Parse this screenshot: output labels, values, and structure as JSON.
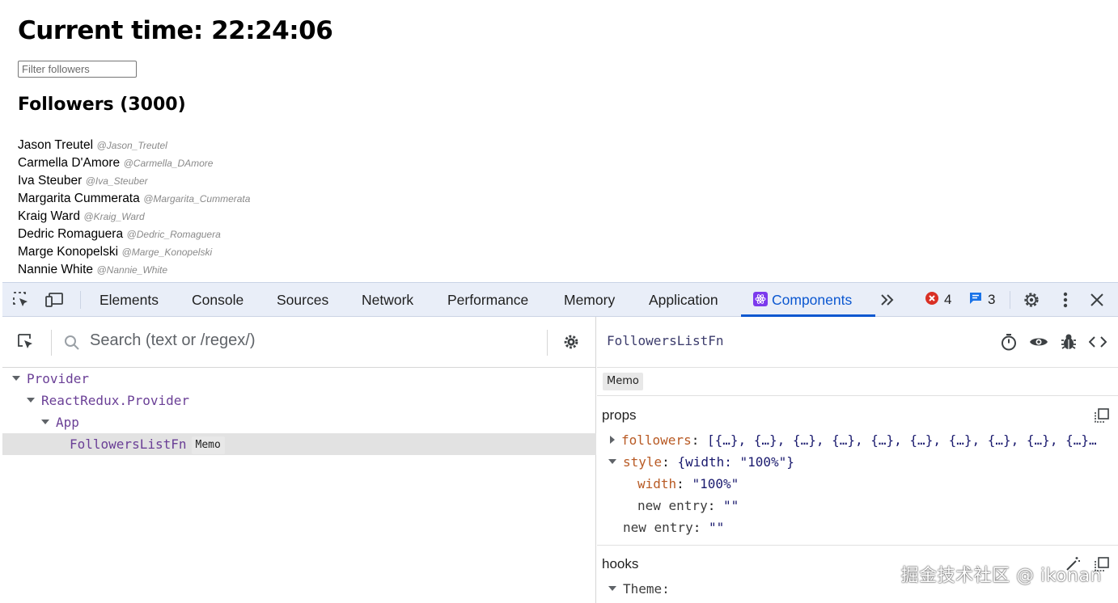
{
  "app": {
    "title": "Current time: 22:24:06",
    "filter_placeholder": "Filter followers",
    "followers_heading": "Followers (3000)",
    "followers": [
      {
        "name": "Jason Treutel",
        "handle": "@Jason_Treutel"
      },
      {
        "name": "Carmella D'Amore",
        "handle": "@Carmella_DAmore"
      },
      {
        "name": "Iva Steuber",
        "handle": "@Iva_Steuber"
      },
      {
        "name": "Margarita Cummerata",
        "handle": "@Margarita_Cummerata"
      },
      {
        "name": "Kraig Ward",
        "handle": "@Kraig_Ward"
      },
      {
        "name": "Dedric Romaguera",
        "handle": "@Dedric_Romaguera"
      },
      {
        "name": "Marge Konopelski",
        "handle": "@Marge_Konopelski"
      },
      {
        "name": "Nannie White",
        "handle": "@Nannie_White"
      }
    ]
  },
  "devtools": {
    "tabs": [
      "Elements",
      "Console",
      "Sources",
      "Network",
      "Performance",
      "Memory",
      "Application",
      "Components"
    ],
    "active_tab": "Components",
    "error_count": "4",
    "message_count": "3",
    "search_placeholder": "Search (text or /regex/)",
    "tree": [
      {
        "name": "Provider"
      },
      {
        "name": "ReactRedux.Provider"
      },
      {
        "name": "App"
      },
      {
        "name": "FollowersListFn",
        "badge": "Memo"
      }
    ],
    "inspector": {
      "component_name": "FollowersListFn",
      "badge": "Memo",
      "props_title": "props",
      "props": {
        "followers_key": "followers",
        "followers_value": "[{…}, {…}, {…}, {…}, {…}, {…}, {…}, {…}, {…}, {…}…",
        "style_key": "style",
        "style_value": "{width: \"100%\"}",
        "width_key": "width",
        "width_value": "\"100%\"",
        "new_entry_key": "new entry",
        "new_entry_value": "\"\""
      },
      "hooks_title": "hooks",
      "hooks_first": "Theme:"
    },
    "colors": {
      "active_tab": "#0b57d0",
      "error": "#d93025",
      "message": "#1a73e8",
      "component_name": "#6a3f96",
      "prop_key": "#b85a24"
    }
  },
  "watermark": "掘金技术社区 @ ikonan"
}
